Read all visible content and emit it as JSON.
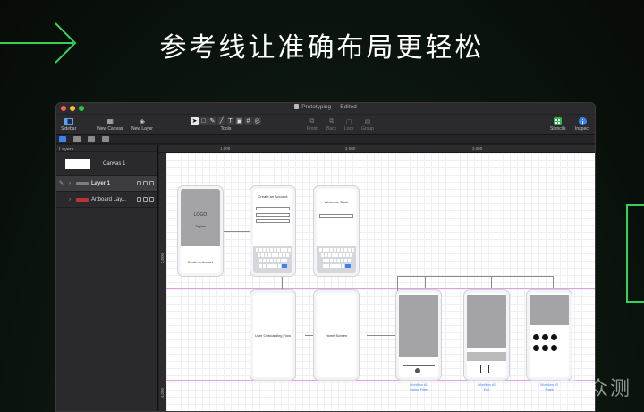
{
  "hero": {
    "title": "参考线让准确布局更轻松"
  },
  "watermark": {
    "text": "新 众测"
  },
  "colors": {
    "accent_green": "#34d058",
    "mac_red": "#ff5f57",
    "mac_yellow": "#febc2e",
    "mac_green": "#28c840",
    "link_blue": "#3b82f6"
  },
  "window": {
    "title": "Prototyping — Edited"
  },
  "toolbar": {
    "sidebar_label": "Sidebar",
    "new_canvas_label": "New Canvas",
    "new_layer_label": "New Layer",
    "tools_label": "Tools",
    "front_label": "Front",
    "back_label": "Back",
    "lock_label": "Lock",
    "group_label": "Group",
    "stencils_label": "Stencils",
    "inspect_label": "Inspect"
  },
  "sidebar": {
    "section_title": "Layers",
    "canvas_name": "Canvas 1",
    "layers": [
      {
        "name": "Layer 1"
      },
      {
        "name": "Artboard Lay..."
      }
    ]
  },
  "rulers": {
    "top": [
      "1,000",
      "2,000",
      "3,000"
    ],
    "left": [
      "2,000",
      "4,000"
    ]
  },
  "screens": {
    "logo_text": "LOGO",
    "tagline": "Tagline",
    "create_account_button": "Create an Account",
    "create_account_title": "Create an Account",
    "welcome_title": "Welcome Back",
    "onboarding_label": "User Onboarding Flow",
    "home_label": "Home Screen"
  },
  "captions": [
    "Workflow #1\nOption Filter",
    "Workflow #2\nEdit",
    "Workflow #3\nShare"
  ]
}
